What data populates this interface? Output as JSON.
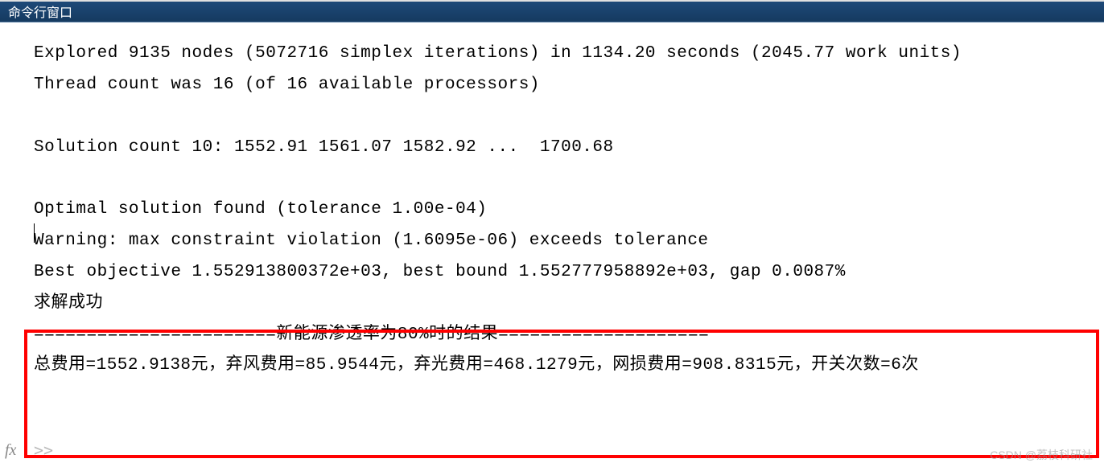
{
  "window": {
    "title": "命令行窗口"
  },
  "output": {
    "line1": "Explored 9135 nodes (5072716 simplex iterations) in 1134.20 seconds (2045.77 work units)",
    "line2": "Thread count was 16 (of 16 available processors)",
    "line3": "",
    "line4": "Solution count 10: 1552.91 1561.07 1582.92 ...  1700.68",
    "line5": "",
    "line6": "Optimal solution found (tolerance 1.00e-04)",
    "line7": "Warning: max constraint violation (1.6095e-06) exceeds tolerance",
    "line8": "Best objective 1.552913800372e+03, best bound 1.552777958892e+03, gap 0.0087%",
    "line9": "求解成功",
    "line10": "=======================新能源渗透率为80%时的结果====================",
    "line11": "总费用=1552.9138元，弃风费用=85.9544元，弃光费用=468.1279元，网损费用=908.8315元，开关次数=6次"
  },
  "prompt": {
    "fx": "fx",
    "arrows": ">>"
  },
  "watermark": "CSDN @荔枝科研社"
}
